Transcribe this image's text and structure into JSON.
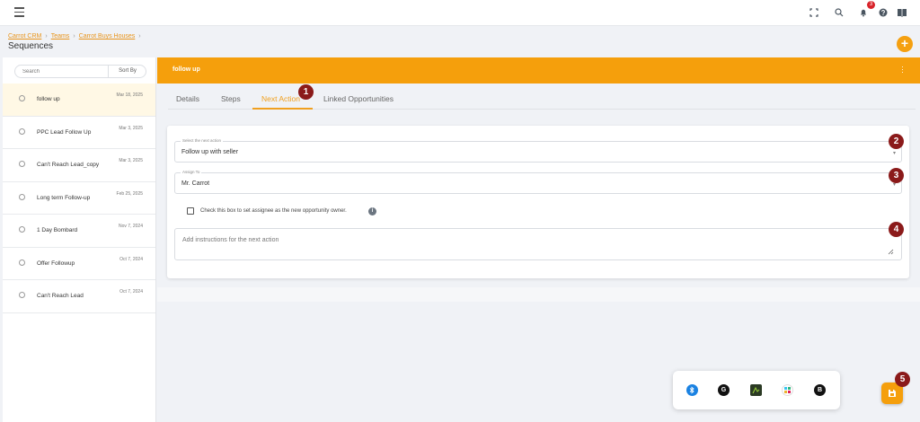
{
  "topbar": {
    "notification_count": "3",
    "icons": [
      "fullscreen-icon",
      "search-icon",
      "bell-icon",
      "help-icon",
      "book-icon"
    ]
  },
  "breadcrumb": {
    "items": [
      "Carrot CRM",
      "Teams",
      "Carrot Buys Houses"
    ],
    "page_title": "Sequences"
  },
  "add_button_label": "+",
  "sidebar": {
    "search_placeholder": "Search",
    "sort_label": "Sort By",
    "items": [
      {
        "name": "follow up",
        "date": "Mar 18, 2025"
      },
      {
        "name": "PPC Lead Follow Up",
        "date": "Mar 3, 2025"
      },
      {
        "name": "Can't Reach Lead_copy",
        "date": "Mar 3, 2025"
      },
      {
        "name": "Long term Follow-up",
        "date": "Feb 25, 2025"
      },
      {
        "name": "1 Day Bombard",
        "date": "Nov 7, 2024"
      },
      {
        "name": "Offer Followup",
        "date": "Oct 7, 2024"
      },
      {
        "name": "Can't Reach Lead",
        "date": "Oct 7, 2024"
      }
    ]
  },
  "panel": {
    "title": "follow up",
    "tabs": [
      {
        "label": "Details"
      },
      {
        "label": "Steps"
      },
      {
        "label": "Next Action"
      },
      {
        "label": "Linked Opportunities"
      }
    ],
    "active_tab": "Next Action"
  },
  "form": {
    "next_action_label": "Select the next action",
    "next_action_value": "Follow up with seller",
    "assign_label": "Assign To",
    "assign_value": "Mr. Carrot",
    "checkbox_label": "Check this box to set assignee as the new opportunity owner.",
    "instructions_placeholder": "Add instructions for the next action"
  },
  "dock": {
    "icons": [
      "bluetooth-icon",
      "grammarly-icon",
      "app-icon",
      "slack-icon",
      "bitwarden-icon"
    ],
    "grammarly_glyph": "G",
    "bitwarden_glyph": "B"
  },
  "markers": [
    "1",
    "2",
    "3",
    "4",
    "5"
  ],
  "colors": {
    "accent": "#f59f0c",
    "marker": "#8b1a1a"
  }
}
